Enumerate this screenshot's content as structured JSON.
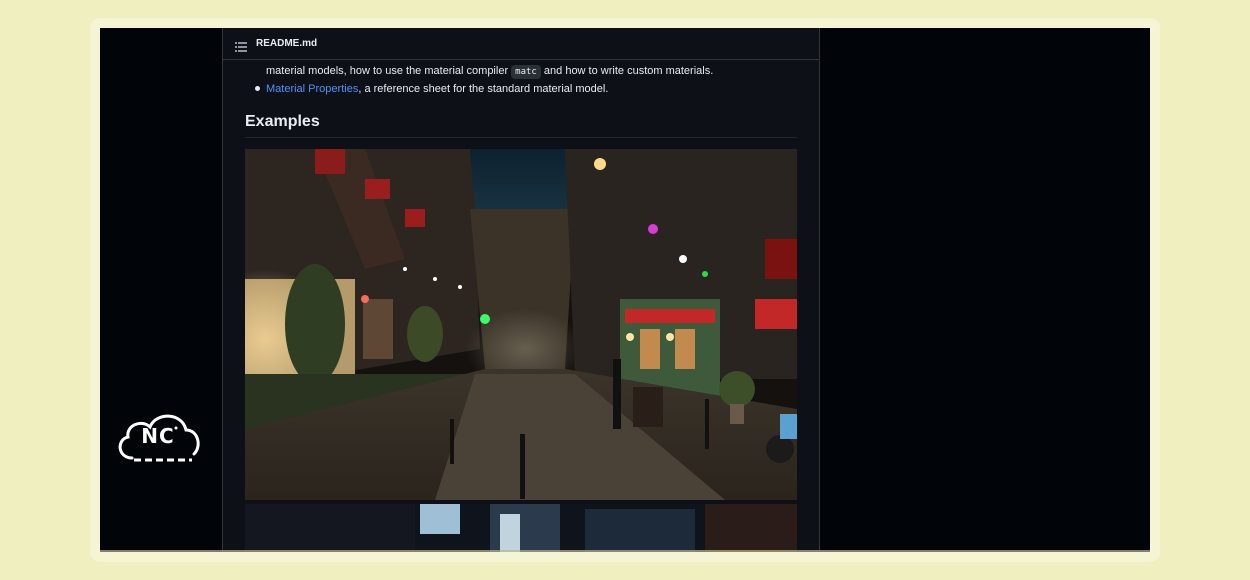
{
  "readme": {
    "file_name": "README.md",
    "intro_line_before": "material models, how to use the material compiler ",
    "intro_code": "matc",
    "intro_line_after": " and how to write custom materials.",
    "bullet_link": "Material Properties",
    "bullet_text": ", a reference sheet for the standard material model.",
    "heading": "Examples"
  },
  "logo": {
    "text": "NC"
  },
  "icons": {
    "list": "list-icon",
    "logo": "cloud-logo-icon"
  },
  "colors": {
    "background": "#efefbf",
    "screen": "#010409",
    "panel": "#0d1117",
    "text": "#e6edf3",
    "link": "#4493f8"
  }
}
